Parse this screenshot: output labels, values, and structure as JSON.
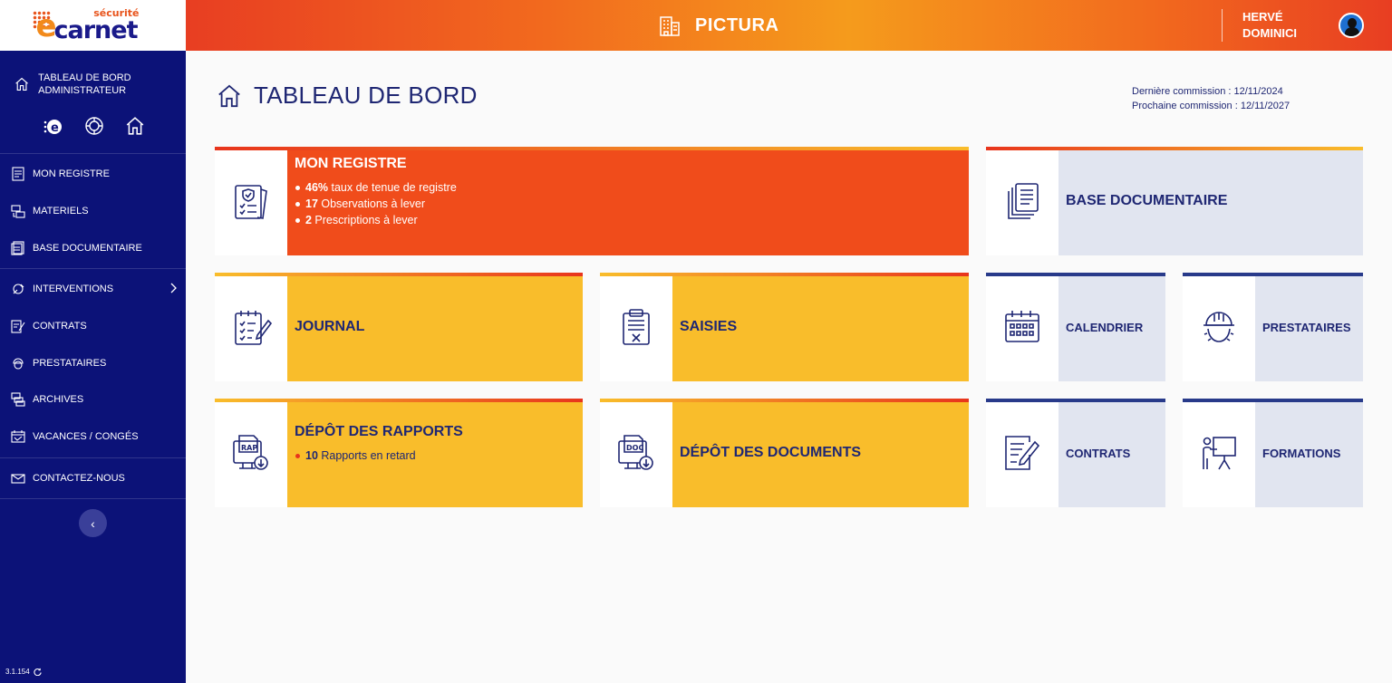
{
  "header": {
    "logo_small": "sécurité",
    "logo_big": "carnet",
    "logo_e": "e",
    "building": "PICTURA",
    "user_name": "HERVÉ DOMINICI"
  },
  "sidebar": {
    "head_label": "TABLEAU DE BORD ADMINISTRATEUR",
    "items": [
      {
        "label": "MON REGISTRE",
        "icon": "register-icon"
      },
      {
        "label": "MATERIELS",
        "icon": "equipment-icon"
      },
      {
        "label": "BASE DOCUMENTAIRE",
        "icon": "documents-icon"
      },
      {
        "label": "INTERVENTIONS",
        "icon": "interventions-icon"
      },
      {
        "label": "CONTRATS",
        "icon": "contract-icon"
      },
      {
        "label": "PRESTATAIRES",
        "icon": "provider-icon"
      },
      {
        "label": "ARCHIVES",
        "icon": "archives-icon"
      },
      {
        "label": "VACANCES / CONGÉS",
        "icon": "vacation-icon"
      },
      {
        "label": "CONTACTEZ-NOUS",
        "icon": "mail-icon"
      }
    ],
    "collapse": "‹",
    "version": "3.1.154"
  },
  "main": {
    "title": "TABLEAU DE BORD",
    "last_commission": "Dernière commission : 12/11/2024",
    "next_commission": "Prochaine commission : 12/11/2027"
  },
  "cards": {
    "registre": {
      "title": "MON REGISTRE",
      "b1_num": "46%",
      "b1_text": " taux de tenue de registre",
      "b2_num": "17",
      "b2_text": " Observations à lever",
      "b3_num": "2",
      "b3_text": " Prescriptions à lever"
    },
    "base_doc": {
      "title": "BASE DOCUMENTAIRE"
    },
    "journal": {
      "title": "JOURNAL"
    },
    "saisies": {
      "title": "SAISIES"
    },
    "calendrier": {
      "title": "CALENDRIER"
    },
    "prestataires": {
      "title": "PRESTATAIRES"
    },
    "rapports": {
      "title": "DÉPÔT DES RAPPORTS",
      "b1_num": "10",
      "b1_text": " Rapports en retard",
      "icon_text": "RAP"
    },
    "documents": {
      "title": "DÉPÔT DES DOCUMENTS",
      "icon_text": "DOC"
    },
    "contrats": {
      "title": "CONTRATS"
    },
    "formations": {
      "title": "FORMATIONS"
    }
  },
  "colors": {
    "sidebar": "#0c1278",
    "orange": "#f04c1b",
    "yellow": "#f9bd2b",
    "light_blue": "#e1e5f0",
    "navy_text": "#1f2773"
  }
}
